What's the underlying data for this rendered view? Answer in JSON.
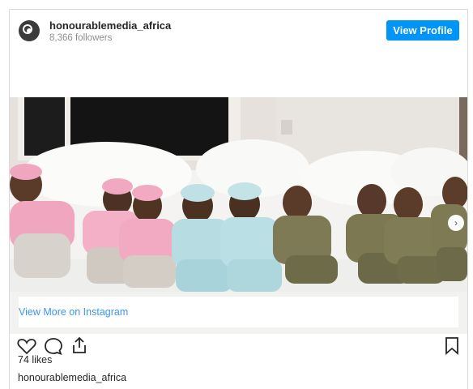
{
  "post": {
    "username": "honourablemedia_africa",
    "followers": "8,366 followers",
    "view_profile_label": "View Profile",
    "view_more_label": "View More on Instagram",
    "likes": "74 likes",
    "caption_username": "honourablemedia_africa"
  },
  "colors": {
    "accent": "#0095f6",
    "link": "#3897f0"
  }
}
